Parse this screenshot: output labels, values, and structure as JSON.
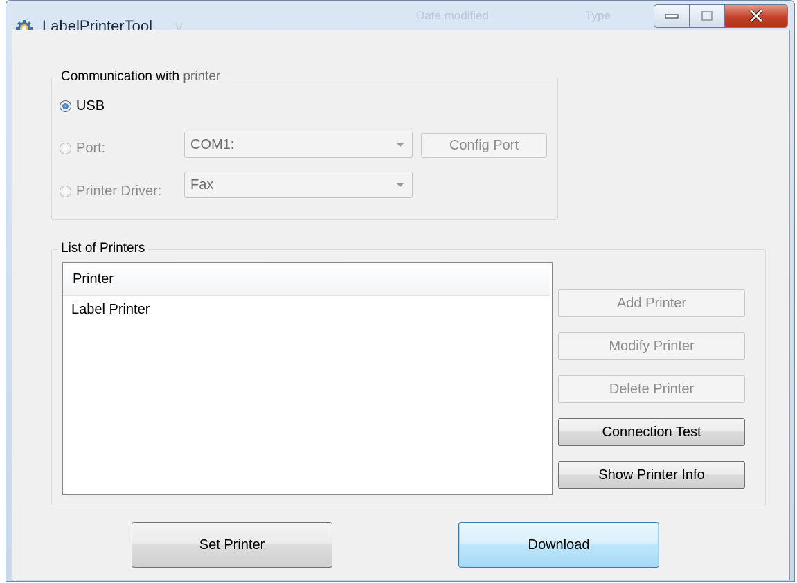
{
  "window": {
    "title": "LabelPrinterTool",
    "title_ghost": "v",
    "background_columns": [
      "Date modified",
      "Type"
    ]
  },
  "communication": {
    "label_main": "Communication with",
    "label_dim": " printer",
    "usb_label": "USB",
    "port_label": "Port:",
    "port_value": "COM1:",
    "config_port_label": "Config Port",
    "driver_label": "Printer Driver:",
    "driver_value": "Fax",
    "selected": "USB"
  },
  "printers": {
    "group_label": "List of Printers",
    "header": "Printer",
    "items": [
      "Label Printer"
    ],
    "buttons": {
      "add": "Add Printer",
      "modify": "Modify Printer",
      "delete": "Delete Printer",
      "test": "Connection Test",
      "info": "Show Printer Info"
    }
  },
  "actions": {
    "set_printer": "Set Printer",
    "download": "Download"
  },
  "colors": {
    "close_button": "#c4412a",
    "focus_button": "#bee6fd",
    "radio_selected": "#1f5ea3"
  }
}
